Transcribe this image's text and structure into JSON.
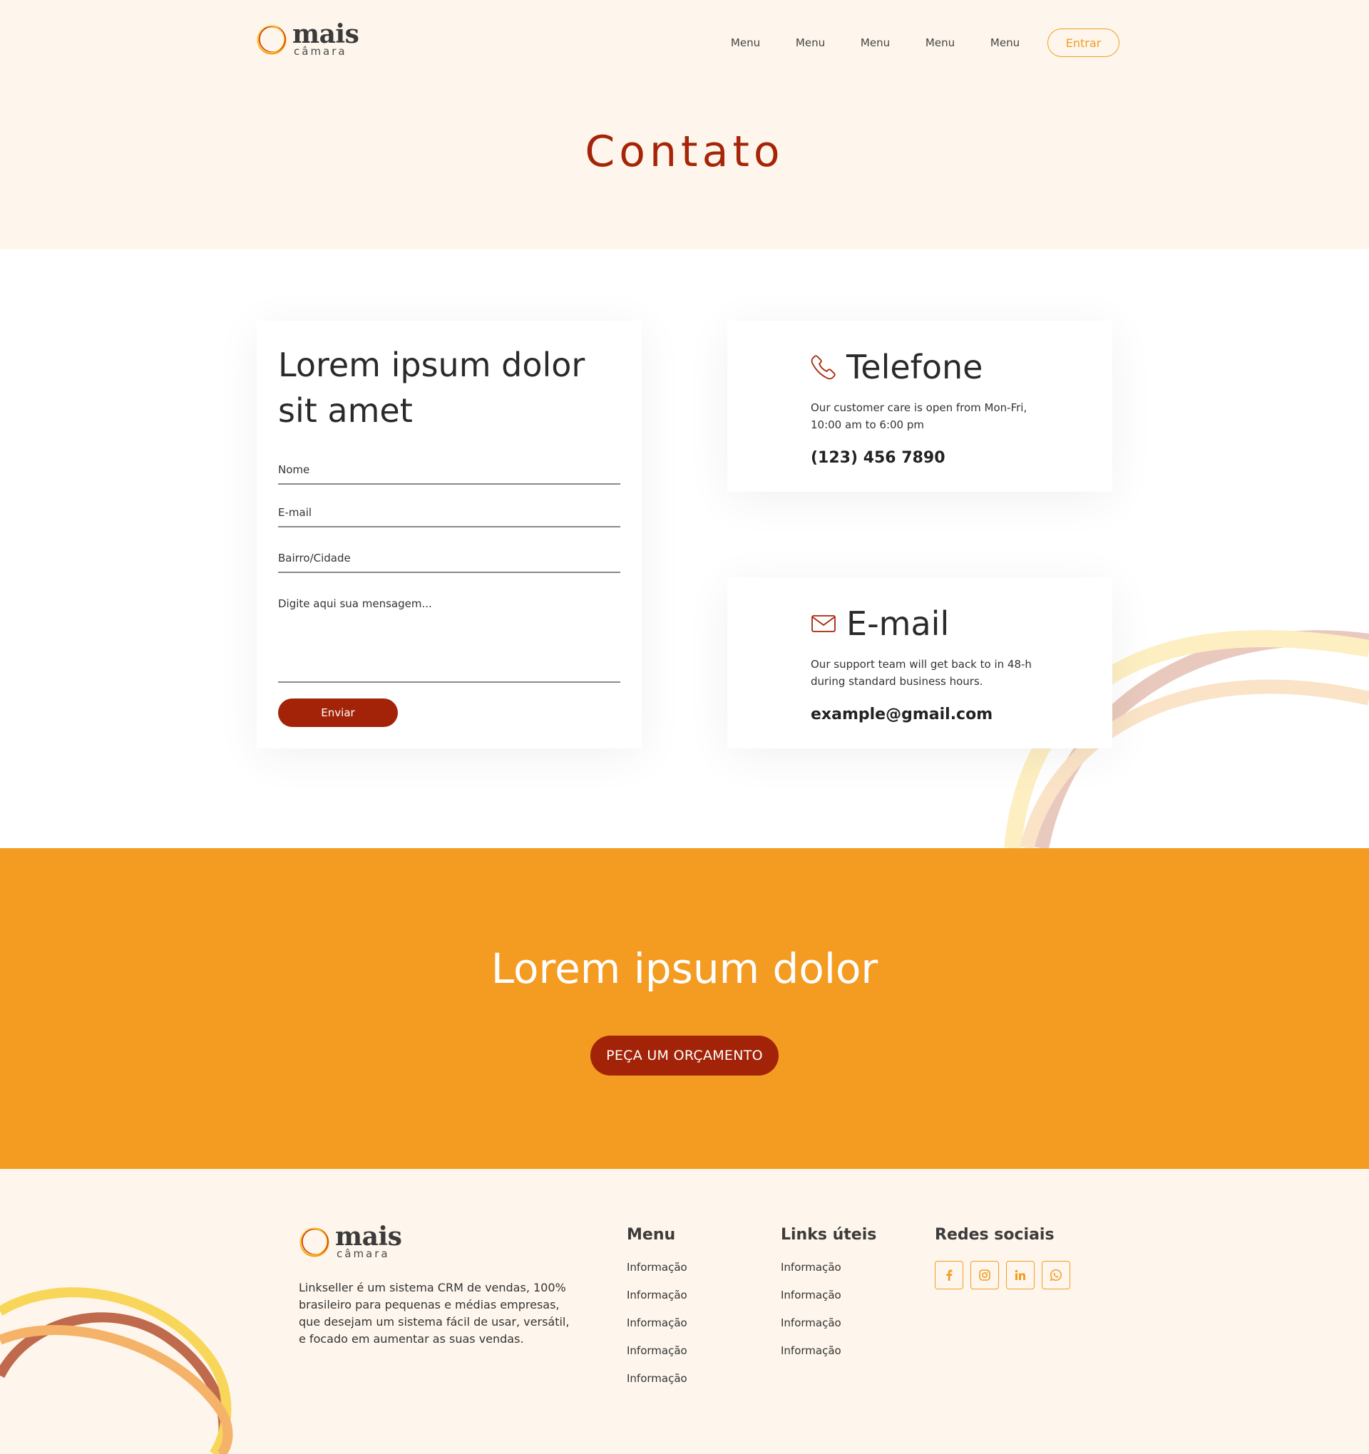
{
  "brand": {
    "word1": "mais",
    "word2": "câmara"
  },
  "nav": {
    "items": [
      "Menu",
      "Menu",
      "Menu",
      "Menu",
      "Menu"
    ],
    "login_label": "Entrar"
  },
  "page_title": "Contato",
  "form": {
    "heading": "Lorem ipsum dolor sit amet",
    "fields": {
      "name": "Nome",
      "email": "E-mail",
      "location": "Bairro/Cidade",
      "message": "Digite aqui sua mensagem..."
    },
    "submit_label": "Enviar"
  },
  "phone_card": {
    "title": "Telefone",
    "description": "Our customer care is open from Mon-Fri, 10:00 am to 6:00 pm",
    "value": "(123) 456 7890",
    "icon": "phone-icon"
  },
  "email_card": {
    "title": "E-mail",
    "description": "Our support team will get back to in 48-h during standard business hours.",
    "value": "example@gmail.com",
    "icon": "envelope-icon"
  },
  "cta": {
    "heading": "Lorem ipsum dolor",
    "button_label": "PEÇA UM ORÇAMENTO"
  },
  "footer": {
    "about": "Linkseller é um sistema CRM de vendas, 100% brasileiro para pequenas e médias empresas, que desejam um sistema fácil de usar, versátil, e focado em aumentar as suas vendas.",
    "menu": {
      "title": "Menu",
      "links": [
        "Informação",
        "Informação",
        "Informação",
        "Informação",
        "Informação"
      ]
    },
    "useful": {
      "title": "Links úteis",
      "links": [
        "Informação",
        "Informação",
        "Informação",
        "Informação"
      ]
    },
    "social": {
      "title": "Redes sociais",
      "icons": [
        "facebook-icon",
        "instagram-icon",
        "linkedin-icon",
        "whatsapp-icon"
      ]
    }
  },
  "colors": {
    "accent": "#f49b22",
    "brand_dark": "#a22308",
    "background": "#fef6ec"
  }
}
